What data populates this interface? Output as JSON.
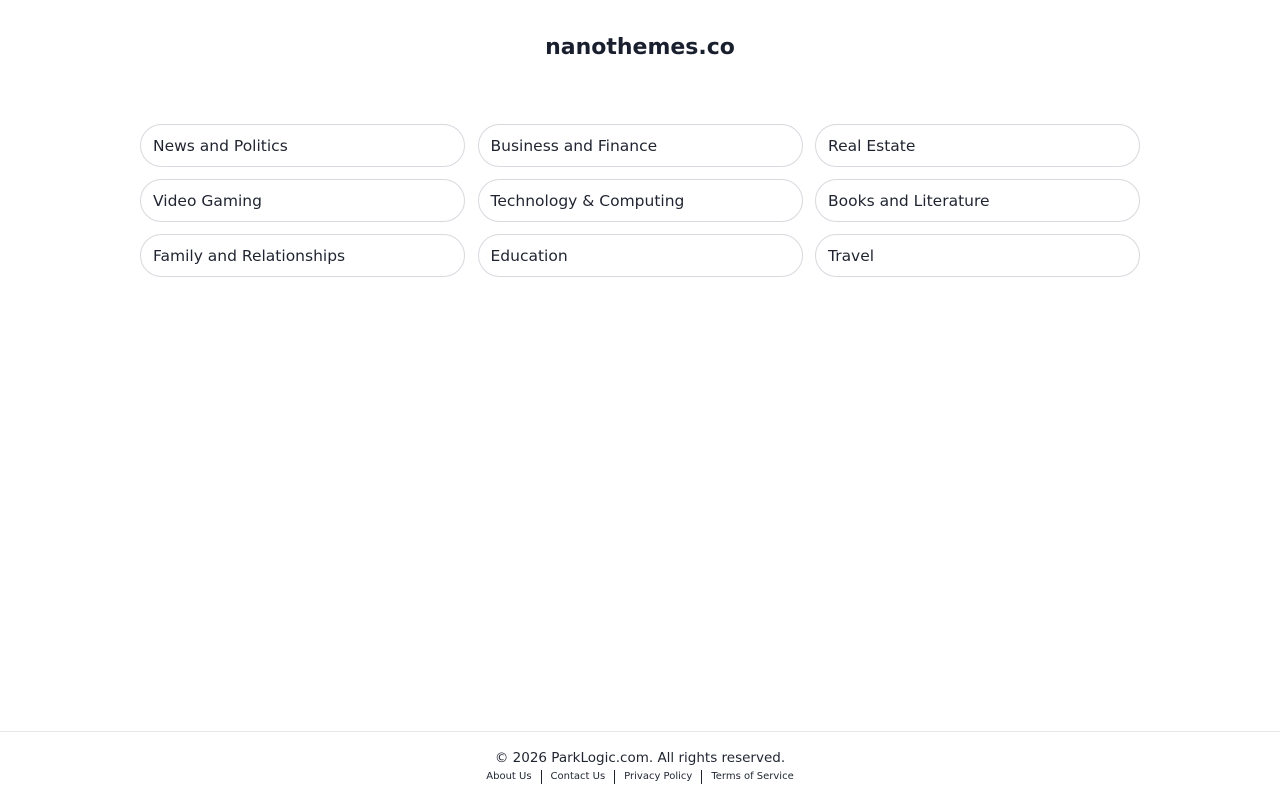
{
  "site": {
    "title": "nanothemes.co"
  },
  "categories": [
    "News and Politics",
    "Business and Finance",
    "Real Estate",
    "Video Gaming",
    "Technology & Computing",
    "Books and Literature",
    "Family and Relationships",
    "Education",
    "Travel"
  ],
  "footer": {
    "copyright": "© 2026 ParkLogic.com. All rights reserved.",
    "links": [
      "About Us",
      "Contact Us",
      "Privacy Policy",
      "Terms of Service"
    ]
  }
}
